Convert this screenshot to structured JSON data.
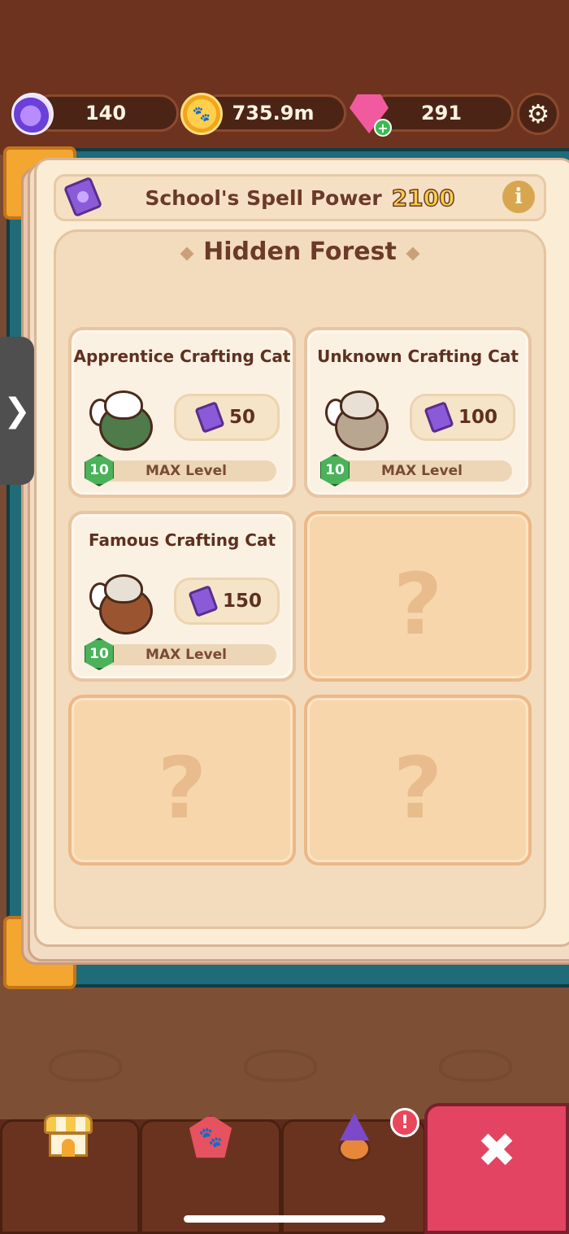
{
  "currencies": {
    "potion": "140",
    "coins": "735.9m",
    "gems": "291",
    "gem_plus": "+"
  },
  "icons": {
    "settings": "⚙",
    "info": "i",
    "side_tab": "❯",
    "close": "✖",
    "alert": "!",
    "paw": "🐾",
    "coin": "🐾"
  },
  "header": {
    "spell_power_label": "School's Spell Power",
    "spell_power_value": "2100"
  },
  "section": {
    "title": "Hidden Forest"
  },
  "cards": [
    {
      "name": "Apprentice Crafting Cat",
      "cost": "50",
      "level": "10",
      "level_label": "MAX Level",
      "body_color": "#4f7a4a"
    },
    {
      "name": "Unknown Crafting Cat",
      "cost": "100",
      "level": "10",
      "level_label": "MAX Level",
      "body_color": "#b9a690"
    },
    {
      "name": "Famous Crafting Cat",
      "cost": "150",
      "level": "10",
      "level_label": "MAX Level",
      "body_color": "#9a5530"
    }
  ],
  "locked": {
    "mark": "?"
  },
  "colors": {
    "accent_close": "#e24462",
    "level_badge": "#4bb25a",
    "spell_book": "#8a5ad8"
  }
}
